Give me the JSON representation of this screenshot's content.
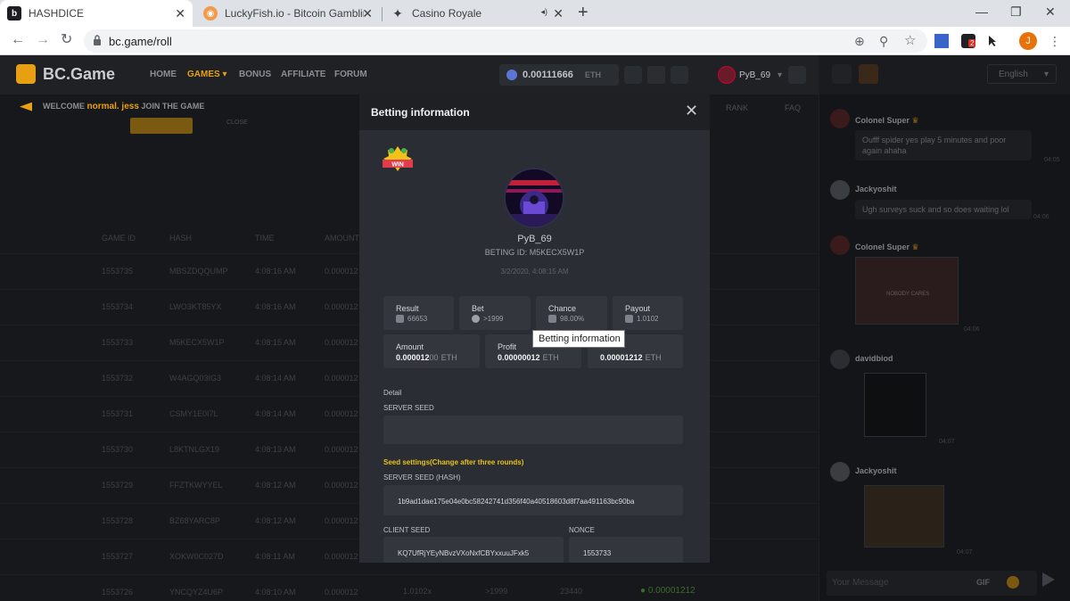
{
  "browser": {
    "tabs": [
      {
        "title": "HASHDICE"
      },
      {
        "title": "LuckyFish.io - Bitcoin Gambling S"
      },
      {
        "title": "Casino Royale"
      }
    ],
    "url": "bc.game/roll",
    "profile_initial": "J",
    "ext_badge": "2"
  },
  "site": {
    "logo": "BC.Game",
    "nav": [
      "HOME",
      "GAMES",
      "BONUS",
      "AFFILIATE",
      "FORUM"
    ],
    "balance": "0.00111666",
    "balance_unit": "ETH",
    "username": "PyB_69",
    "welcome_prefix": "WELCOME",
    "welcome_name": "normal. jess",
    "welcome_suffix": "JOIN THE GAME",
    "rank_label": "RANK",
    "faq_label": "FAQ",
    "close_label": "CLOSE",
    "table_headers": [
      "GAME ID",
      "HASH",
      "TIME",
      "AMOUNT"
    ],
    "rows": [
      {
        "id": "1553735",
        "hash": "MBSZDQQUMP",
        "time": "4:08:16 AM",
        "amount": "0.000012"
      },
      {
        "id": "1553734",
        "hash": "LWO3KT85YX",
        "time": "4:08:16 AM",
        "amount": "0.000012"
      },
      {
        "id": "1553733",
        "hash": "M5KECX5W1P",
        "time": "4:08:15 AM",
        "amount": "0.000012"
      },
      {
        "id": "1553732",
        "hash": "W4AGQ03IG3",
        "time": "4:08:14 AM",
        "amount": "0.000012"
      },
      {
        "id": "1553731",
        "hash": "CSMY1E0I7L",
        "time": "4:08:14 AM",
        "amount": "0.000012"
      },
      {
        "id": "1553730",
        "hash": "L8KTNLGX19",
        "time": "4:08:13 AM",
        "amount": "0.000012"
      },
      {
        "id": "1553729",
        "hash": "FFZTKWYYEL",
        "time": "4:08:12 AM",
        "amount": "0.000012"
      },
      {
        "id": "1553728",
        "hash": "BZ68YARC8P",
        "time": "4:08:12 AM",
        "amount": "0.000012"
      },
      {
        "id": "1553727",
        "hash": "XOKW0C027D",
        "time": "4:08:11 AM",
        "amount": "0.000012"
      },
      {
        "id": "1553726",
        "hash": "YNCQYZ4U6P",
        "time": "4:08:10 AM",
        "amount": "0.000012"
      }
    ],
    "last_row_extra": {
      "payout": "1.0102x",
      "bet": ">1999",
      "result": "23440",
      "profit": "0.00001212"
    }
  },
  "chat": {
    "language": "English",
    "messages": [
      {
        "user": "Colonel Super",
        "text": "Oufff spider yes play 5 minutes and poor again ahaha",
        "time": "04:05"
      },
      {
        "user": "Jackyoshit",
        "text": "Ugh surveys suck and so does waiting lol",
        "time": "04:06"
      },
      {
        "user": "Colonel Super",
        "img_text": "NOBODY CARES",
        "time": "04:06"
      },
      {
        "user": "davidbiod",
        "time": "04:07"
      },
      {
        "user": "Jackyoshit",
        "time": "04:07"
      }
    ],
    "input_placeholder": "Your Message",
    "gif_label": "GIF"
  },
  "modal": {
    "title": "Betting information",
    "badge": "WIN",
    "username": "PyB_69",
    "bet_id": "BETING ID: M5KECX5W1P",
    "datetime": "3/2/2020, 4:08:15 AM",
    "stats": {
      "result_label": "Result",
      "result_value": "66653",
      "bet_label": "Bet",
      "bet_value": ">1999",
      "chance_label": "Chance",
      "chance_value": "98.00%",
      "payout_label": "Payout",
      "payout_value": "1.0102",
      "amount_label": "Amount",
      "amount_main": "0.000012",
      "amount_dim": "00",
      "amount_unit": "ETH",
      "profit_label": "Profit",
      "profit_main": "0.00000012",
      "profit_unit": "ETH",
      "third_value": "0.00001212",
      "third_unit": "ETH"
    },
    "tooltip": "Betting information",
    "detail_label": "Detail",
    "server_seed_label": "SERVER SEED",
    "server_seed_value": "",
    "seed_settings_label": "Seed settings(Change after three rounds)",
    "server_seed_hash_label": "SERVER SEED (HASH)",
    "server_seed_hash_value": "1b9ad1dae175e04e0bc58242741d356f40a40518603d8f7aa491163bc90ba",
    "client_seed_label": "CLIENT SEED",
    "client_seed_value": "KQ7UfRjYEyNBvzVXoNxfCBYxxuuJFxk5",
    "nonce_label": "NONCE",
    "nonce_value": "1553733"
  }
}
